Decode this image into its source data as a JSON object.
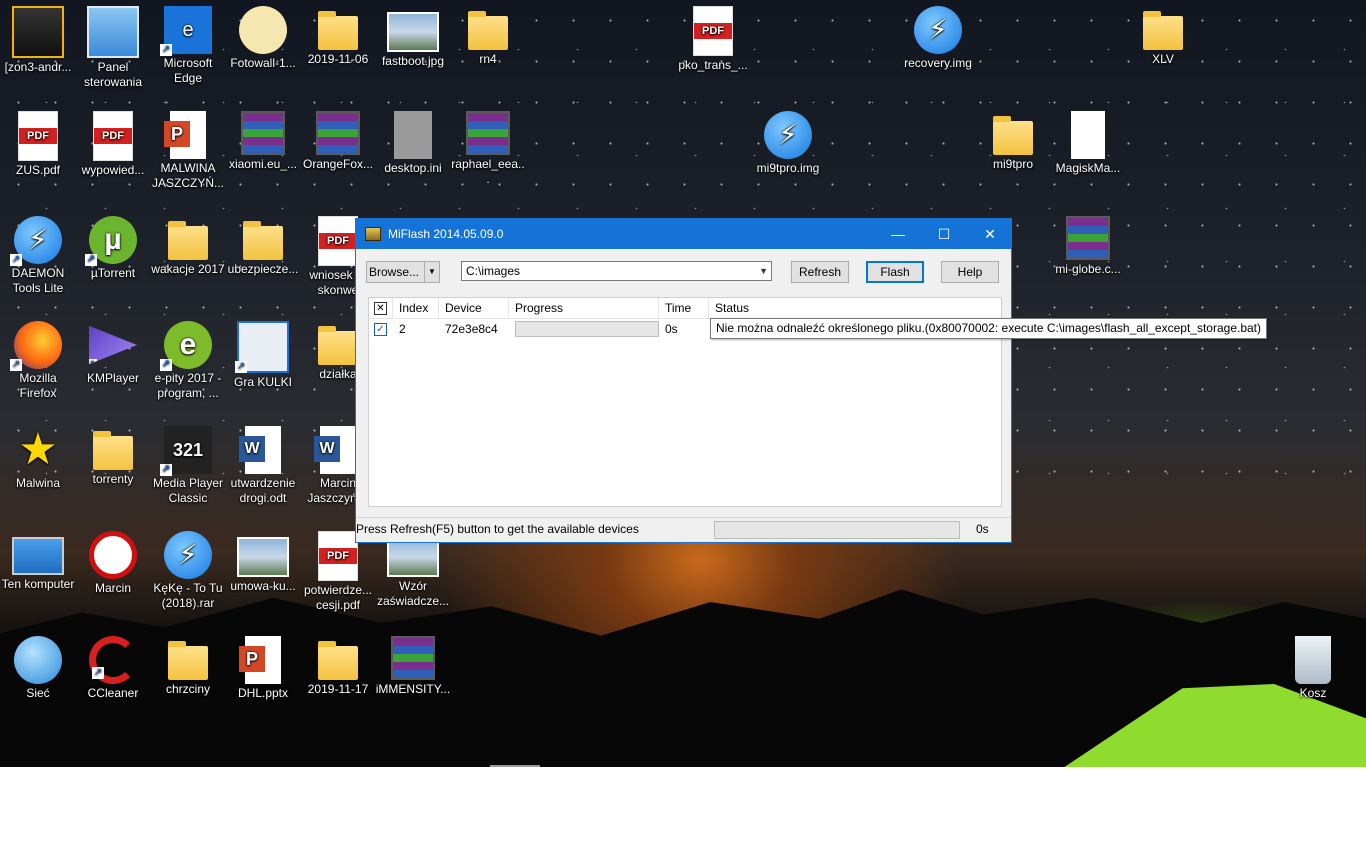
{
  "desktop_icons": [
    {
      "label": "[zon3-andr...",
      "kind": "zon3",
      "shortcut": false
    },
    {
      "label": "Panel sterowania",
      "kind": "panel",
      "shortcut": false
    },
    {
      "label": "Microsoft Edge",
      "kind": "edge",
      "shortcut": true
    },
    {
      "label": "Fotowall-1...",
      "kind": "fotowall",
      "shortcut": false
    },
    {
      "label": "2019-11-06",
      "kind": "folder",
      "shortcut": false
    },
    {
      "label": "fastboot.jpg",
      "kind": "imgfile",
      "shortcut": false
    },
    {
      "label": "rn4",
      "kind": "folder",
      "shortcut": false
    },
    {
      "label": "pko_trans_...",
      "kind": "pdf",
      "shortcut": false
    },
    {
      "label": "recovery.img",
      "kind": "daemon",
      "shortcut": false
    },
    {
      "label": "XLV",
      "kind": "folder",
      "shortcut": false
    },
    {
      "label": "ZUS.pdf",
      "kind": "pdf",
      "shortcut": false
    },
    {
      "label": "wypowied...",
      "kind": "pdf",
      "shortcut": false
    },
    {
      "label": "MALWINA JASZCZYŃ...",
      "kind": "ppt",
      "shortcut": false
    },
    {
      "label": "xiaomi.eu_...",
      "kind": "rar",
      "shortcut": false
    },
    {
      "label": "OrangeFox...",
      "kind": "rar",
      "shortcut": false
    },
    {
      "label": "desktop.ini",
      "kind": "gear",
      "shortcut": false
    },
    {
      "label": "raphael_eea...",
      "kind": "rar",
      "shortcut": false
    },
    {
      "label": "mi9tpro.img",
      "kind": "daemon",
      "shortcut": false
    },
    {
      "label": "mi9tpro",
      "kind": "folder",
      "shortcut": false
    },
    {
      "label": "MagiskMa...",
      "kind": "blankfile",
      "shortcut": false
    },
    {
      "label": "DAEMON Tools Lite",
      "kind": "daemon",
      "shortcut": true
    },
    {
      "label": "µTorrent",
      "kind": "utor",
      "shortcut": true
    },
    {
      "label": "wakacje 2017",
      "kind": "folder",
      "shortcut": false
    },
    {
      "label": "ubezpiecze...",
      "kind": "folder",
      "shortcut": false
    },
    {
      "label": "wniosek 1-skonwe",
      "kind": "pdf",
      "shortcut": false
    },
    {
      "label": "mi-globe.c...",
      "kind": "rar",
      "shortcut": false
    },
    {
      "label": "Mozilla Firefox",
      "kind": "firefox",
      "shortcut": true
    },
    {
      "label": "KMPlayer",
      "kind": "kmp",
      "shortcut": true
    },
    {
      "label": "e-pity 2017 - program, ...",
      "kind": "epity",
      "shortcut": true
    },
    {
      "label": "Gra KULKI",
      "kind": "gra",
      "shortcut": true
    },
    {
      "label": "działka",
      "kind": "folder",
      "shortcut": false
    },
    {
      "label": "Malwina",
      "kind": "star",
      "shortcut": false
    },
    {
      "label": "torrenty",
      "kind": "folder",
      "shortcut": false
    },
    {
      "label": "Media Player Classic",
      "kind": "mpc",
      "shortcut": true
    },
    {
      "label": "utwardzenie drogi.odt",
      "kind": "word",
      "shortcut": false
    },
    {
      "label": "Marcin Jaszczyńsk",
      "kind": "word",
      "shortcut": false
    },
    {
      "label": "Ten komputer",
      "kind": "pc",
      "shortcut": false
    },
    {
      "label": "Marcin",
      "kind": "nopark",
      "shortcut": false
    },
    {
      "label": "KęKę - To Tu (2018).rar",
      "kind": "daemon",
      "shortcut": false
    },
    {
      "label": "umowa-ku...",
      "kind": "imgfile",
      "shortcut": false
    },
    {
      "label": "potwierdze... cesji.pdf",
      "kind": "pdf",
      "shortcut": false
    },
    {
      "label": "Wzór zaświadcze...",
      "kind": "imgfile",
      "shortcut": false
    },
    {
      "label": "Sieć",
      "kind": "globe",
      "shortcut": false
    },
    {
      "label": "CCleaner",
      "kind": "ccl",
      "shortcut": true
    },
    {
      "label": "chrzciny",
      "kind": "folder",
      "shortcut": false
    },
    {
      "label": "DHL.pptx",
      "kind": "ppt",
      "shortcut": false
    },
    {
      "label": "2019-11-17",
      "kind": "folder",
      "shortcut": false
    },
    {
      "label": "iMMENSITY...",
      "kind": "rar",
      "shortcut": false
    },
    {
      "label": "Kosz",
      "kind": "bin",
      "shortcut": false
    }
  ],
  "window": {
    "title": "MiFlash 2014.05.09.0",
    "controls": {
      "minimize": "—",
      "maximize": "☐",
      "close": "✕"
    },
    "browse_label": "Browse...",
    "path_value": "C:\\images",
    "refresh_label": "Refresh",
    "flash_label": "Flash",
    "help_label": "Help",
    "columns": [
      "Index",
      "Device",
      "Progress",
      "Time",
      "Status"
    ],
    "rows": [
      {
        "checked": true,
        "index": "2",
        "device": "72e3e8c4",
        "progress": 0,
        "time": "0s",
        "status": "Nie można odnaleźć określonego pliku.(0x80070002: execute C:\\images\\flash_all_except_storage.bat)"
      }
    ],
    "status_message": "Press Refresh(F5) button to get the available devices",
    "status_time": "0s"
  },
  "colors": {
    "titlebar": "#1573d8",
    "accent": "#0078d7"
  }
}
